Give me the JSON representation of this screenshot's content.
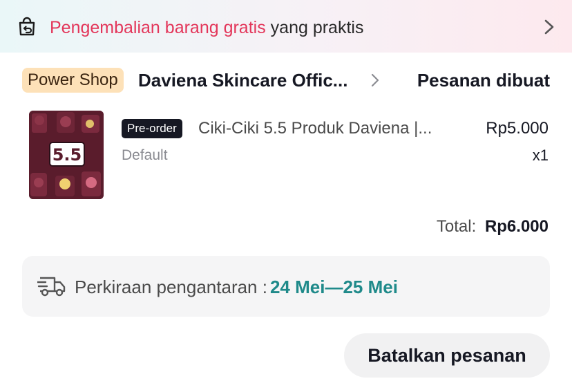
{
  "banner": {
    "highlight": "Pengembalian barang gratis",
    "rest": "yang praktis",
    "icon": "return-bag-icon",
    "chevron_icon": "chevron-right-icon"
  },
  "shop": {
    "badge": "Power Shop",
    "name": "Daviena Skincare Offic...",
    "status": "Pesanan dibuat"
  },
  "product": {
    "badge": "Pre-order",
    "title": "Ciki-Ciki 5.5 Produk Daviena |...",
    "price": "Rp5.000",
    "variant": "Default",
    "quantity": "x1",
    "image_text": "5.5"
  },
  "total": {
    "label": "Total:",
    "value": "Rp6.000"
  },
  "delivery": {
    "label": "Perkiraan pengantaran :",
    "date": "24 Mei—25 Mei",
    "icon": "delivery-truck-icon"
  },
  "actions": {
    "cancel_label": "Batalkan pesanan"
  },
  "colors": {
    "highlight": "#e3365a",
    "delivery_date": "#1f8a8a",
    "power_badge_bg": "#fde1b8",
    "preorder_badge_bg": "#161823",
    "product_image_bg": "#5a1c2c"
  }
}
